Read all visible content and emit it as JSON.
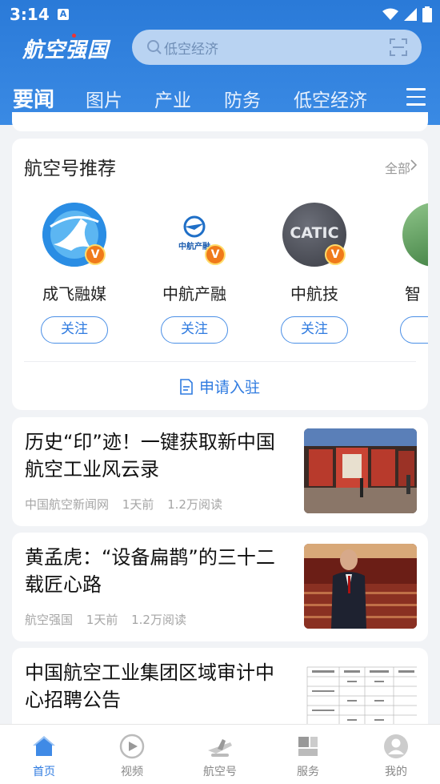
{
  "status_bar": {
    "time": "3:14",
    "notification_badge": "A"
  },
  "header": {
    "logo_text": "航空强国",
    "search_placeholder": "低空经济",
    "tabs": [
      "要闻",
      "图片",
      "产业",
      "防务",
      "低空经济"
    ],
    "active_tab": "要闻",
    "colors": {
      "header_bg": "#2a7ad8",
      "accent": "#2f7be0",
      "badge": "#f07a1a"
    }
  },
  "recommend": {
    "title": "航空号推荐",
    "all_label": "全部",
    "accounts": [
      {
        "name": "成飞融媒",
        "follow": "关注",
        "icon": "chengfei-logo"
      },
      {
        "name": "中航产融",
        "follow": "关注",
        "icon": "avic-finance-logo",
        "logo_text": "中航产融"
      },
      {
        "name": "中航技",
        "follow": "关注",
        "icon": "catic-logo",
        "logo_text": "CATIC"
      },
      {
        "name": "智",
        "follow": "",
        "icon": "partial-logo"
      }
    ],
    "verified_badge": "V",
    "apply_label": "申请入驻"
  },
  "news": [
    {
      "title": "历史“印”迹！一键获取新中国航空工业风云录",
      "source": "中国航空新闻网",
      "time": "1天前",
      "reads": "1.2万阅读"
    },
    {
      "title": "黄孟虎：“设备扁鹊”的三十二载匠心路",
      "source": "航空强国",
      "time": "1天前",
      "reads": "1.2万阅读"
    },
    {
      "title": "中国航空工业集团区域审计中心招聘公告",
      "source": "",
      "time": "",
      "reads": ""
    }
  ],
  "bottom_nav": [
    {
      "label": "首页",
      "icon": "home-icon",
      "active": true
    },
    {
      "label": "视频",
      "icon": "video-icon",
      "active": false
    },
    {
      "label": "航空号",
      "icon": "plane-icon",
      "active": false
    },
    {
      "label": "服务",
      "icon": "service-icon",
      "active": false
    },
    {
      "label": "我的",
      "icon": "profile-icon",
      "active": false
    }
  ]
}
